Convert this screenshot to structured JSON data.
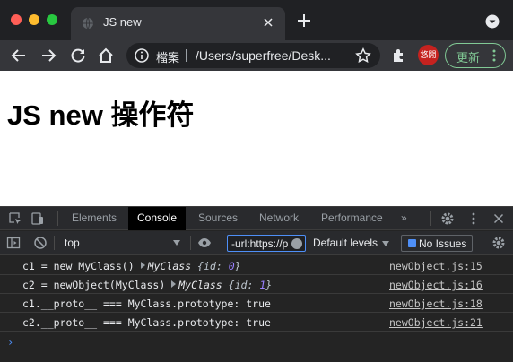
{
  "browser": {
    "tab_title": "JS new",
    "omnibox_label": "檔案",
    "url": "/Users/superfree/Desk...",
    "avatar_text": "悠閒",
    "update_label": "更新"
  },
  "page": {
    "heading": "JS new 操作符"
  },
  "devtools": {
    "tabs": [
      {
        "label": "Elements",
        "active": false
      },
      {
        "label": "Console",
        "active": true
      },
      {
        "label": "Sources",
        "active": false
      },
      {
        "label": "Network",
        "active": false
      },
      {
        "label": "Performance",
        "active": false
      }
    ],
    "more_tabs": "»",
    "context": "top",
    "filter_value": "-url:https://p",
    "levels_label": "Default levels",
    "issues_label": "No Issues",
    "logs": [
      {
        "prefix": "c1 = new MyClass()",
        "obj_name": "MyClass",
        "obj_key": "id",
        "obj_value": "0",
        "source": "newObject.js:15"
      },
      {
        "prefix": "c2 = newObject(MyClass)",
        "obj_name": "MyClass",
        "obj_key": "id",
        "obj_value": "1",
        "source": "newObject.js:16"
      },
      {
        "text": "c1.__proto__ === MyClass.prototype: true",
        "source": "newObject.js:18"
      },
      {
        "text": "c2.__proto__ === MyClass.prototype: true",
        "source": "newObject.js:21"
      }
    ],
    "prompt": "›"
  },
  "colors": {
    "chrome_bg": "#202124",
    "toolbar_bg": "#35363a",
    "devtools_bg": "#242424",
    "accent_blue": "#4e8ff7",
    "update_green": "#81c995"
  }
}
